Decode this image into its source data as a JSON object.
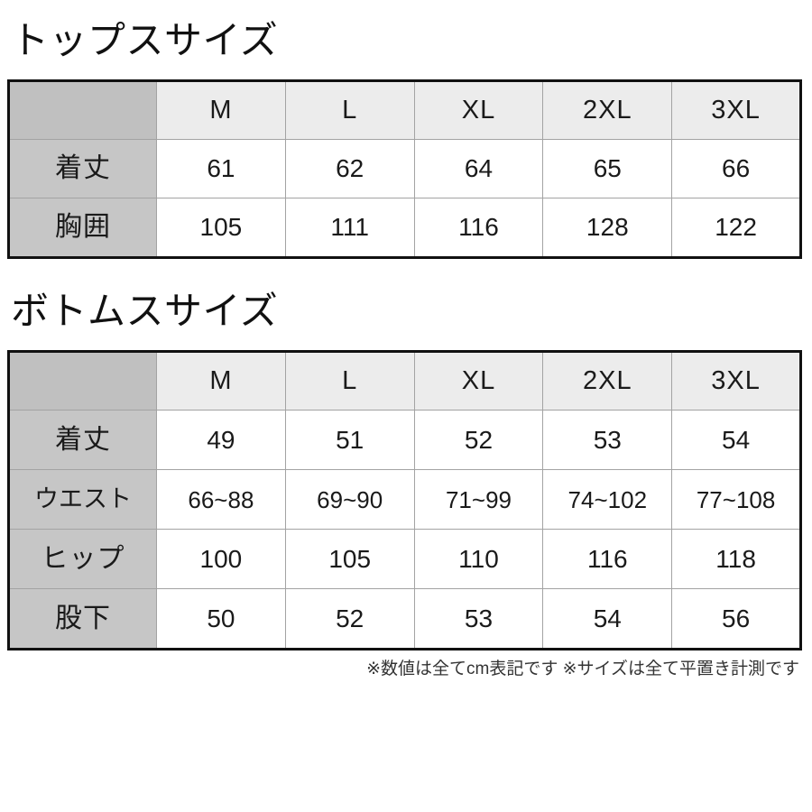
{
  "document": {
    "kind": "apparel-size-chart",
    "measurement_unit": "cm"
  },
  "tops": {
    "title": "トップスサイズ",
    "corner_label": "",
    "size_headers": [
      "M",
      "L",
      "XL",
      "2XL",
      "3XL"
    ],
    "rows": [
      {
        "label": "着丈",
        "values": [
          "61",
          "62",
          "64",
          "65",
          "66"
        ]
      },
      {
        "label": "胸囲",
        "values": [
          "105",
          "111",
          "116",
          "128",
          "122"
        ]
      }
    ]
  },
  "bottoms": {
    "title": "ボトムスサイズ",
    "corner_label": "",
    "size_headers": [
      "M",
      "L",
      "XL",
      "2XL",
      "3XL"
    ],
    "rows": [
      {
        "label": "着丈",
        "values": [
          "49",
          "51",
          "52",
          "53",
          "54"
        ]
      },
      {
        "label": "ウエスト",
        "values": [
          "66~88",
          "69~90",
          "71~99",
          "74~102",
          "77~108"
        ]
      },
      {
        "label": "ヒップ",
        "values": [
          "100",
          "105",
          "110",
          "116",
          "118"
        ]
      },
      {
        "label": "股下",
        "values": [
          "50",
          "52",
          "53",
          "54",
          "56"
        ]
      }
    ]
  },
  "footnote": {
    "text": "※数値は全てcm表記です ※サイズは全て平置き計測です"
  },
  "colors": {
    "page_background": "#ffffff",
    "table_outer_border": "#111111",
    "table_inner_border": "#a3a3a3",
    "header_cell_background": "#ececec",
    "corner_cell_background": "#c0c0c0",
    "row_label_background": "#c6c6c6",
    "data_cell_background": "#ffffff",
    "text": "#1a1a1a",
    "footnote_text": "#333333"
  }
}
